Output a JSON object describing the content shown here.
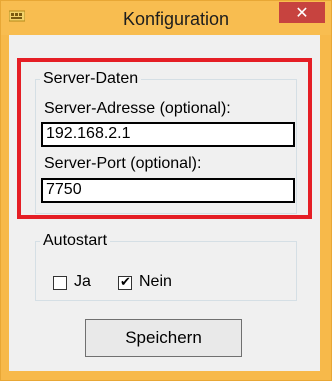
{
  "window": {
    "title": "Konfiguration",
    "close_symbol": "✕"
  },
  "server_group": {
    "legend": "Server-Daten",
    "address_label": "Server-Adresse (optional):",
    "address_value": "192.168.2.1",
    "port_label": "Server-Port (optional):",
    "port_value": "7750"
  },
  "autostart_group": {
    "legend": "Autostart",
    "options": [
      {
        "label": "Ja",
        "checked": false
      },
      {
        "label": "Nein",
        "checked": true
      }
    ]
  },
  "actions": {
    "save_label": "Speichern"
  },
  "colors": {
    "titlebar": "#f8bd50",
    "close_button": "#c7433f",
    "highlight_border": "#e51e25",
    "client_background": "#f0f0f0"
  },
  "icons": {
    "app_icon": "app-icon",
    "close_icon": "close-icon",
    "checkmark_icon": "checkmark-icon"
  }
}
